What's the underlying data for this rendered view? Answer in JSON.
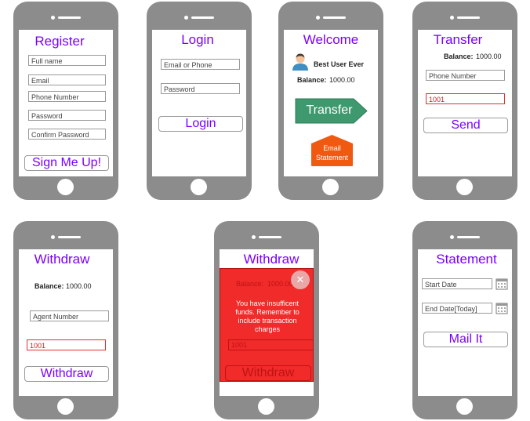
{
  "register": {
    "title": "Register",
    "fields": [
      "Full name",
      "Email",
      "Phone Number",
      "Password",
      "Confirm Password"
    ],
    "button": "Sign Me Up!"
  },
  "login": {
    "title": "Login",
    "fields": [
      "Email or Phone",
      "Password"
    ],
    "button": "Login"
  },
  "welcome": {
    "title": "Welcome",
    "user": "Best User Ever",
    "balance_label": "Balance:",
    "balance": "1000.00",
    "transfer": "Transfer",
    "statement_line1": "Email",
    "statement_line2": "Statement"
  },
  "transfer": {
    "title": "Transfer",
    "balance_label": "Balance:",
    "balance": "1000.00",
    "phone_placeholder": "Phone Number",
    "amount": "1001",
    "button": "Send"
  },
  "withdraw": {
    "title": "Withdraw",
    "balance_label": "Balance:",
    "balance": "1000.00",
    "agent_placeholder": "Agent Number",
    "amount": "1001",
    "button": "Withdraw"
  },
  "withdraw_error": {
    "title": "Withdraw",
    "balance_label": "Balance:",
    "balance": "1000.00",
    "message": "You have insufficent funds. Remember to include transaction charges",
    "amount": "1001",
    "button": "Withdraw",
    "close": "✕",
    "overlay_color": "#f01818"
  },
  "statement": {
    "title": "Statement",
    "start_placeholder": "Start Date",
    "end_placeholder": "End Date[Today]",
    "button": "Mail It"
  },
  "colors": {
    "accent": "#7a00ff",
    "transfer_green": "#3e9a6e",
    "email_orange": "#f05a10",
    "phone_gray": "#8c8c8c"
  }
}
